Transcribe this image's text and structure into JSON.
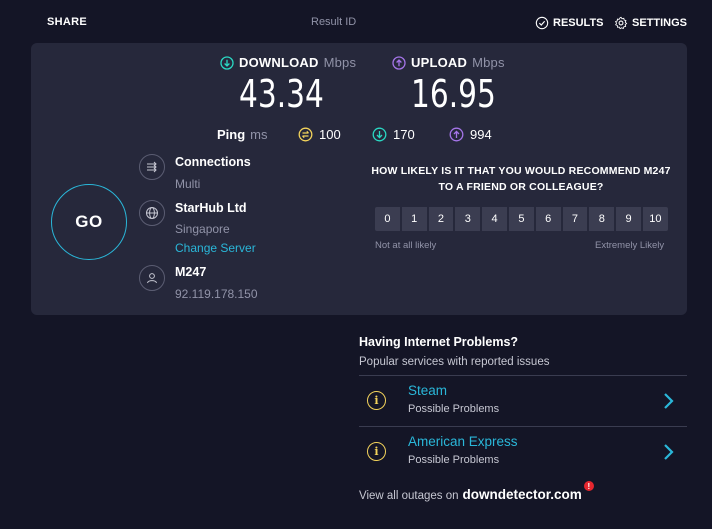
{
  "header": {
    "share_label": "SHARE",
    "result_id_label": "Result ID",
    "results_label": "RESULTS",
    "settings_label": "SETTINGS"
  },
  "speed": {
    "download": {
      "label": "DOWNLOAD",
      "unit": "Mbps",
      "value": "43.34",
      "color": "#2ad9c4"
    },
    "upload": {
      "label": "UPLOAD",
      "unit": "Mbps",
      "value": "16.95",
      "color": "#a575e9"
    },
    "ping": {
      "label": "Ping",
      "unit": "ms",
      "idle": "100",
      "download": "170",
      "upload": "994"
    }
  },
  "go_label": "GO",
  "connection": {
    "connections_title": "Connections",
    "connections_value": "Multi",
    "isp_name": "StarHub Ltd",
    "isp_location": "Singapore",
    "change_server_label": "Change Server",
    "user_provider": "M247",
    "user_ip": "92.119.178.150"
  },
  "survey": {
    "question_line1": "HOW LIKELY IS IT THAT YOU WOULD RECOMMEND M247",
    "question_line2": "TO A FRIEND OR COLLEAGUE?",
    "scale": [
      "0",
      "1",
      "2",
      "3",
      "4",
      "5",
      "6",
      "7",
      "8",
      "9",
      "10"
    ],
    "low_label": "Not at all likely",
    "high_label": "Extremely Likely"
  },
  "problems": {
    "title": "Having Internet Problems?",
    "subtitle": "Popular services with reported issues",
    "items": [
      {
        "name": "Steam",
        "status": "Possible Problems"
      },
      {
        "name": "American Express",
        "status": "Possible Problems"
      }
    ],
    "view_all_text": "View all outages on",
    "brand": "downdetector.com",
    "brand_badge": "!"
  },
  "colors": {
    "background": "#141526",
    "panel": "#26283b",
    "accent_link": "#2ab7d9",
    "ping_idle": "#f3d35b",
    "warning": "#f3d35b"
  }
}
